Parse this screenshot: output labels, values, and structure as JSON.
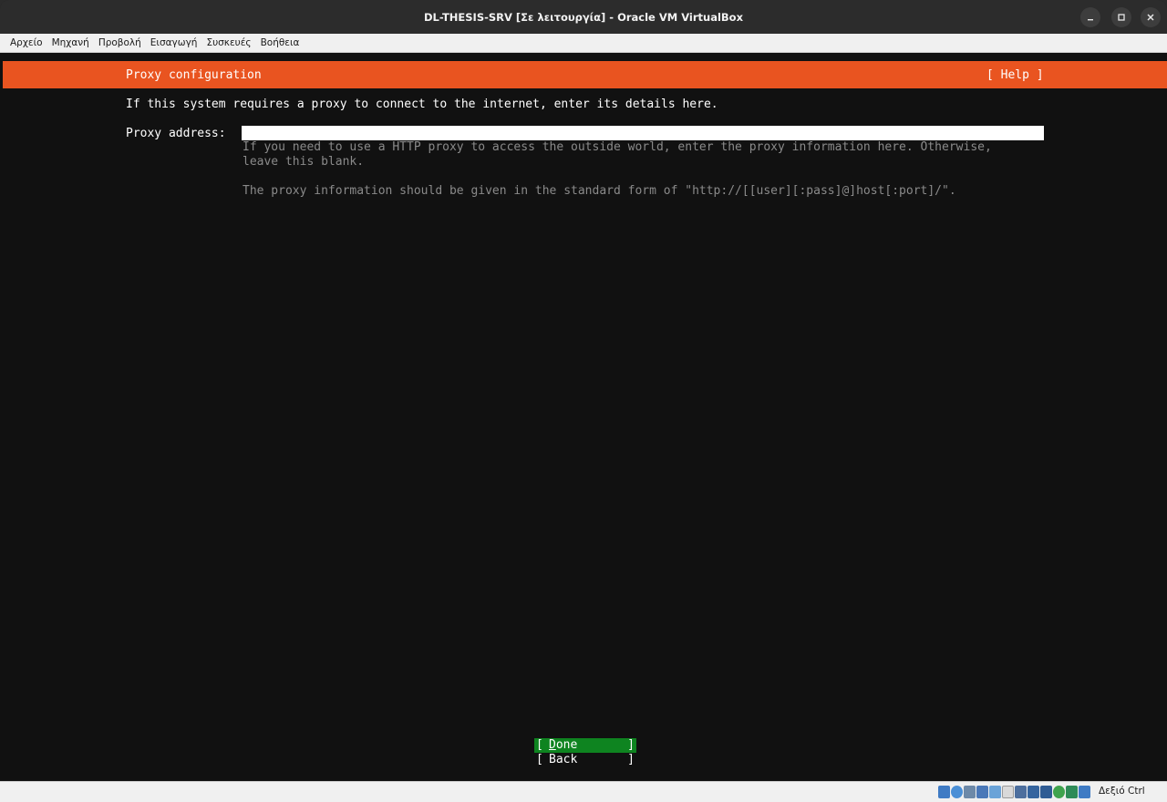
{
  "window": {
    "title": "DL-THESIS-SRV [Σε λειτουργία] - Oracle VM VirtualBox"
  },
  "menubar": {
    "items": [
      {
        "label": "Αρχείο"
      },
      {
        "label": "Μηχανή"
      },
      {
        "label": "Προβολή"
      },
      {
        "label": "Εισαγωγή"
      },
      {
        "label": "Συσκευές"
      },
      {
        "label": "Βοήθεια"
      }
    ]
  },
  "installer": {
    "header_title": "Proxy configuration",
    "help_label": "[ Help ]",
    "intro": "If this system requires a proxy to connect to the internet, enter its details here.",
    "proxy_label": "Proxy address:",
    "proxy_value": "",
    "help_line1": "If you need to use a HTTP proxy to access the outside world, enter the proxy information here. Otherwise,",
    "help_line2": "leave this blank.",
    "help_line3": "The proxy information should be given in the standard form of \"http://[[user][:pass]@]host[:port]/\".",
    "done_first": "D",
    "done_rest": "one",
    "back_label": "Back"
  },
  "statusbar": {
    "icons": [
      "hard-disk-icon",
      "optical-drive-icon",
      "audio-icon",
      "network-icon",
      "usb-icon",
      "shared-folders-icon",
      "display-icon",
      "video-capture-icon",
      "recording-icon",
      "cpu-icon",
      "mouse-integration-icon",
      "keyboard-icon"
    ],
    "host_key": "Δεξιό Ctrl"
  },
  "colors": {
    "header": "#e95420",
    "selected_button": "#0e8420",
    "screen_bg": "#111111"
  }
}
